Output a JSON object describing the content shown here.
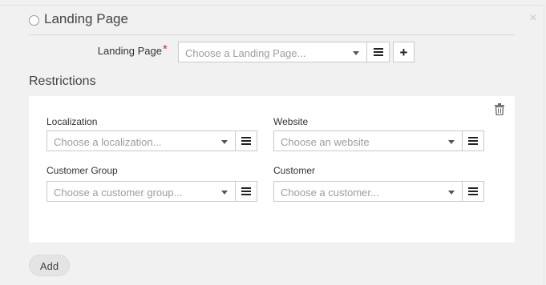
{
  "section": {
    "title": "Landing Page"
  },
  "landing_page": {
    "label": "Landing Page",
    "required_marker": "*",
    "placeholder": "Choose a Landing Page..."
  },
  "restrictions": {
    "title": "Restrictions",
    "fields": {
      "localization": {
        "label": "Localization",
        "placeholder": "Choose a localization..."
      },
      "website": {
        "label": "Website",
        "placeholder": "Choose an website"
      },
      "customer_group": {
        "label": "Customer Group",
        "placeholder": "Choose a customer group..."
      },
      "customer": {
        "label": "Customer",
        "placeholder": "Choose a customer..."
      }
    }
  },
  "actions": {
    "add_label": "Add"
  },
  "icons": {
    "close": "close-icon",
    "menu": "hamburger-menu-icon",
    "plus": "plus-icon",
    "trash": "trash-icon",
    "caret": "caret-down-icon",
    "radio": "radio-icon"
  },
  "colors": {
    "required": "#c0392b",
    "background": "#f1f1f1",
    "card": "#ffffff"
  }
}
